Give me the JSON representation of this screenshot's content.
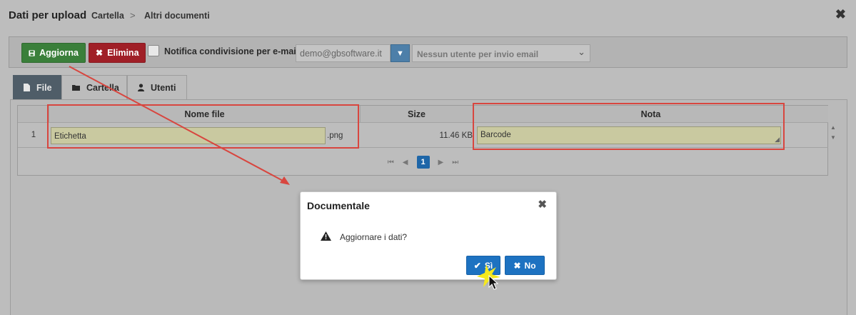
{
  "header": {
    "title": "Dati per upload",
    "breadcrumb": [
      "Cartella",
      "Altri documenti"
    ],
    "separator": ">",
    "close_glyph": "✖"
  },
  "toolbar": {
    "update_label": "Aggiorna",
    "delete_label": "Elimina",
    "notify_label": "Notifica condivisione per e-mail",
    "notify_checked": false,
    "email_value": "demo@gbsoftware.it",
    "user_select_placeholder": "Nessun utente per invio email"
  },
  "tabs": [
    {
      "label": "File",
      "active": true
    },
    {
      "label": "Cartella",
      "active": false
    },
    {
      "label": "Utenti",
      "active": false
    }
  ],
  "grid": {
    "columns": [
      "Nome file",
      "Size",
      "Nota"
    ],
    "rows": [
      {
        "num": "1",
        "name": "Etichetta",
        "ext": ".png",
        "size": "11.46 KB",
        "nota": "Barcode"
      }
    ],
    "pager": {
      "current_page": "1"
    }
  },
  "dialog": {
    "title": "Documentale",
    "message": "Aggiornare i dati?",
    "yes_label": "Sì",
    "no_label": "No",
    "close_glyph": "✖"
  },
  "colors": {
    "overlay": "#bdbdbd",
    "update_button": "#3a7f3a",
    "delete_button": "#a01f27",
    "primary": "#1d72c1",
    "highlight": "#d8463f",
    "active_tab": "#4f5d68"
  }
}
